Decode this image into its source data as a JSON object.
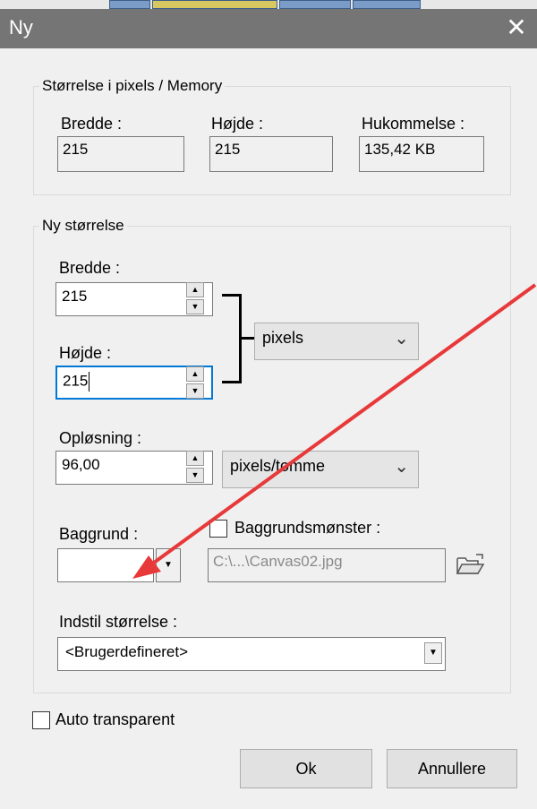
{
  "window": {
    "title": "Ny",
    "close_label": "✕"
  },
  "size_memory": {
    "legend": "Størrelse i pixels / Memory",
    "width_label": "Bredde :",
    "width_value": "215",
    "height_label": "Højde :",
    "height_value": "215",
    "memory_label": "Hukommelse :",
    "memory_value": "135,42 KB"
  },
  "new_size": {
    "legend": "Ny størrelse",
    "width_label": "Bredde :",
    "width_value": "215",
    "height_label": "Højde :",
    "height_value": "215",
    "unit": "pixels",
    "resolution_label": "Opløsning :",
    "resolution_value": "96,00",
    "resolution_unit": "pixels/tomme",
    "background_label": "Baggrund :",
    "pattern_label": "Baggrundsmønster :",
    "pattern_path": "C:\\...\\Canvas02.jpg",
    "preset_label": "Indstil størrelse :",
    "preset_value": "<Brugerdefineret>"
  },
  "auto_transparent_label": "Auto transparent",
  "buttons": {
    "ok": "Ok",
    "cancel": "Annullere"
  },
  "annotation": {
    "arrow_color": "#e8393a"
  },
  "colors": {
    "titlebar": "#757575",
    "focus": "#0078d7"
  }
}
